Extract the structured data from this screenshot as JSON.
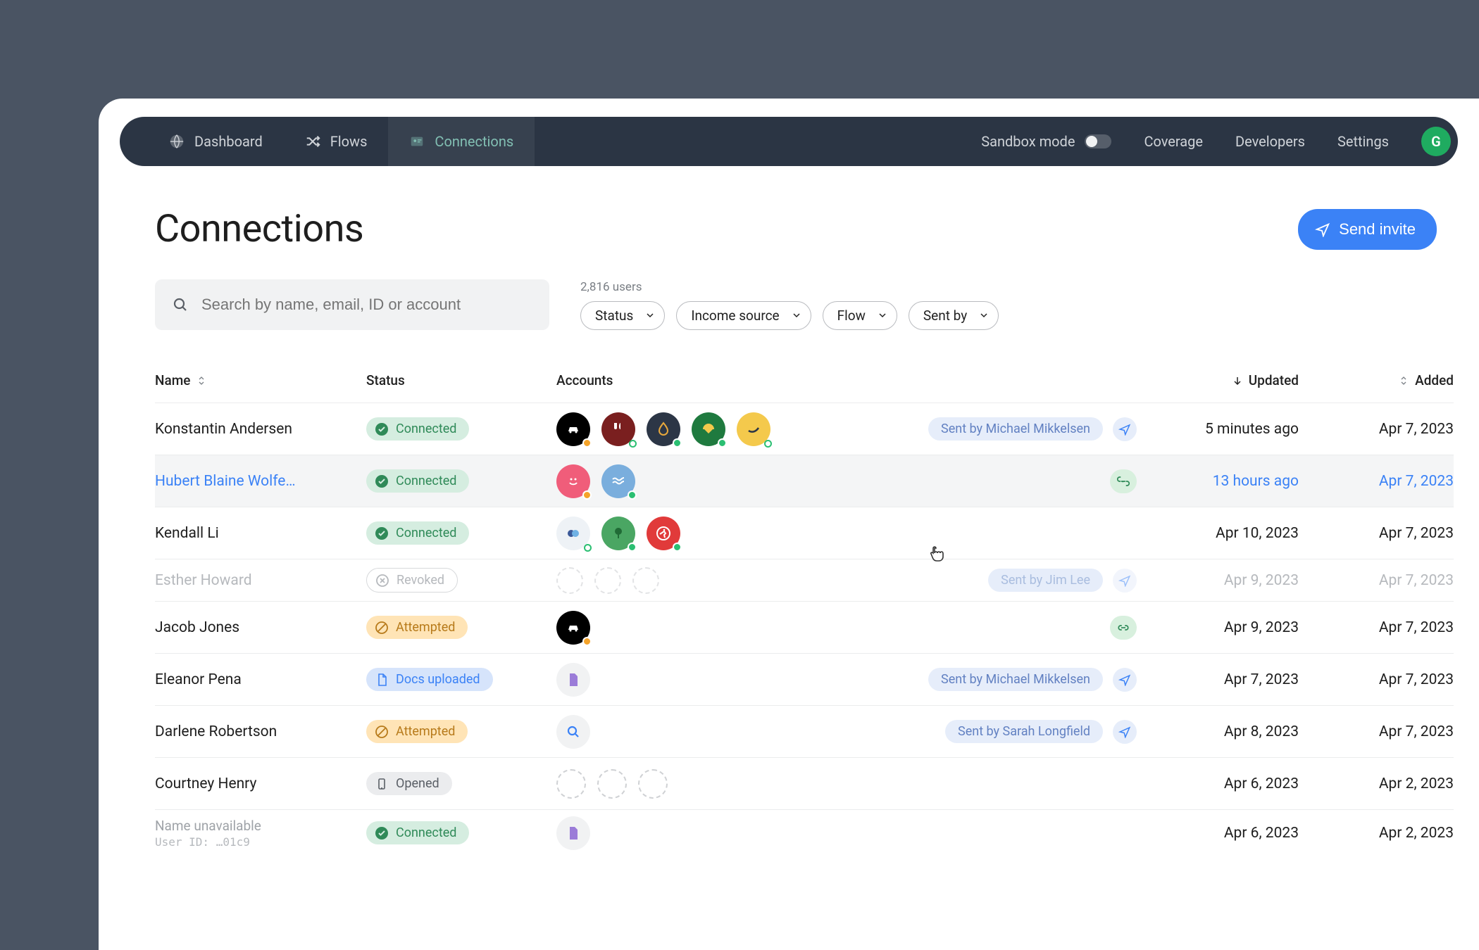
{
  "nav": {
    "dashboard": "Dashboard",
    "flows": "Flows",
    "connections": "Connections",
    "sandbox": "Sandbox mode",
    "coverage": "Coverage",
    "developers": "Developers",
    "settings": "Settings",
    "avatar_letter": "G"
  },
  "header": {
    "title": "Connections",
    "send_invite": "Send invite"
  },
  "search": {
    "placeholder": "Search by name, email, ID or account"
  },
  "filters": {
    "count": "2,816 users",
    "status": "Status",
    "income_source": "Income source",
    "flow": "Flow",
    "sent_by": "Sent by"
  },
  "columns": {
    "name": "Name",
    "status": "Status",
    "accounts": "Accounts",
    "updated": "Updated",
    "added": "Added"
  },
  "status_labels": {
    "connected": "Connected",
    "revoked": "Revoked",
    "attempted": "Attempted",
    "docs": "Docs uploaded",
    "opened": "Opened"
  },
  "sent_by_labels": {
    "mikkelsen": "Sent by Michael Mikkelsen",
    "lee": "Sent by Jim Lee",
    "longfield": "Sent by Sarah Longfield"
  },
  "rows": [
    {
      "name": "Konstantin Andersen",
      "updated": "5 minutes ago",
      "added": "Apr 7, 2023"
    },
    {
      "name": "Hubert Blaine Wolfe…",
      "updated": "13 hours ago",
      "added": "Apr 7, 2023"
    },
    {
      "name": "Kendall Li",
      "updated": "Apr 10, 2023",
      "added": "Apr 7, 2023"
    },
    {
      "name": "Esther Howard",
      "updated": "Apr 9, 2023",
      "added": "Apr 7, 2023"
    },
    {
      "name": "Jacob Jones",
      "updated": "Apr 9, 2023",
      "added": "Apr 7, 2023"
    },
    {
      "name": "Eleanor Pena",
      "updated": "Apr 7, 2023",
      "added": "Apr 7, 2023"
    },
    {
      "name": "Darlene Robertson",
      "updated": "Apr 8, 2023",
      "added": "Apr 7, 2023"
    },
    {
      "name": "Courtney Henry",
      "updated": "Apr 6, 2023",
      "added": "Apr 2, 2023"
    },
    {
      "name": "Name unavailable",
      "sub": "User ID: …01c9",
      "updated": "Apr 6, 2023",
      "added": "Apr 2, 2023"
    }
  ]
}
